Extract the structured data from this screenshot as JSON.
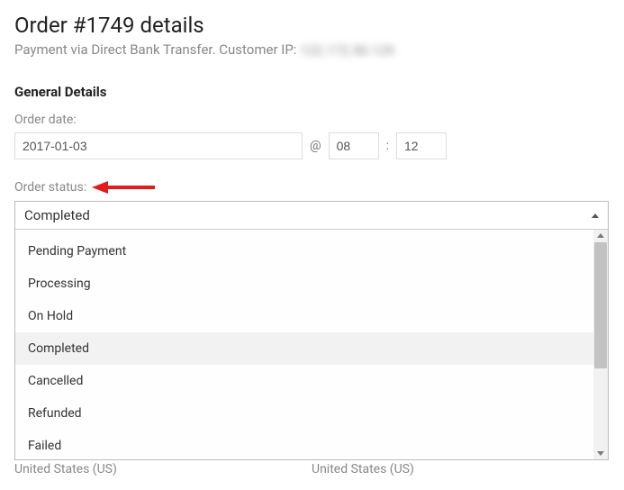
{
  "header": {
    "title": "Order #1749 details",
    "subtitle_prefix": "Payment via Direct Bank Transfer. Customer IP: ",
    "ip_masked": "122.172.50.129"
  },
  "general": {
    "heading": "General Details",
    "order_date_label": "Order date:",
    "order_date": "2017-01-03",
    "at_sep": "@",
    "hour": "08",
    "colon_sep": ":",
    "minute": "12",
    "status_label": "Order status:",
    "selected_status": "Completed",
    "status_options": [
      "Pending Payment",
      "Processing",
      "On Hold",
      "Completed",
      "Cancelled",
      "Refunded",
      "Failed"
    ]
  },
  "footer": {
    "left": "United States (US)",
    "right": "United States (US)"
  },
  "colors": {
    "arrow": "#e31b1b"
  }
}
